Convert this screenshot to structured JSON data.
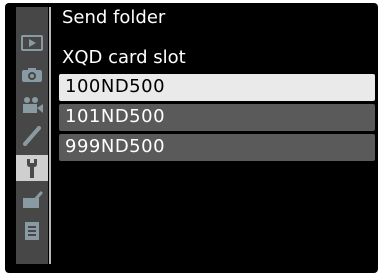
{
  "menu": {
    "title": "Send folder",
    "subtitle": "XQD card slot",
    "folders": [
      "100ND500",
      "101ND500",
      "999ND500"
    ],
    "selected_index": 0
  },
  "sidebar": {
    "tabs": [
      "playback-icon",
      "camera-icon",
      "movie-icon",
      "pencil-icon",
      "wrench-icon",
      "retouch-icon",
      "my-menu-icon"
    ],
    "active_index": 4
  }
}
